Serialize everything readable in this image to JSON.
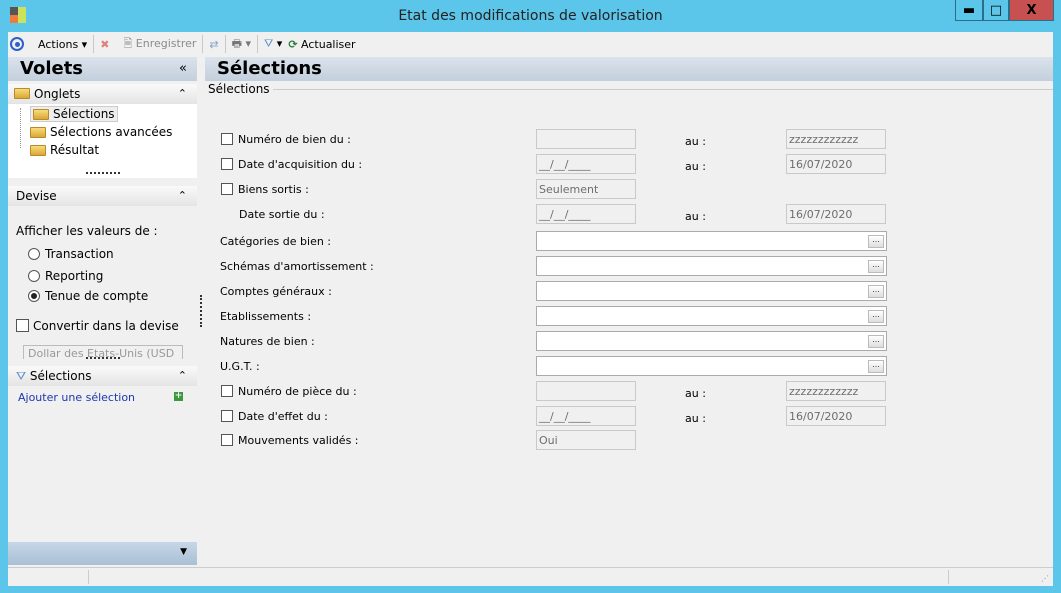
{
  "window": {
    "title": "Etat des modifications de valorisation",
    "minimize": "▬",
    "maximize": "□",
    "close": "X"
  },
  "toolbar": {
    "actions": "Actions",
    "save": "Enregistrer",
    "refresh": "Actualiser"
  },
  "left": {
    "title": "Volets",
    "collapse": "«",
    "onglets": {
      "title": "Onglets",
      "items": [
        "Sélections",
        "Sélections avancées",
        "Résultat"
      ]
    },
    "devise": {
      "title": "Devise",
      "prompt": "Afficher les valeurs de :",
      "options": [
        "Transaction",
        "Reporting",
        "Tenue de compte"
      ],
      "selected": 2,
      "convert_label": "Convertir dans la devise",
      "currency": "Dollar des Etats-Unis (USD"
    },
    "selections": {
      "title": "Sélections",
      "add_link": "Ajouter une sélection"
    }
  },
  "main": {
    "title": "Sélections",
    "group": "Sélections",
    "au": "au :",
    "rows": [
      {
        "label": "Numéro de bien du :",
        "check": true,
        "from": "",
        "to": "zzzzzzzzzzzz"
      },
      {
        "label": "Date d'acquisition du :",
        "check": true,
        "from": "__/__/____",
        "to": "16/07/2020"
      },
      {
        "label": "Biens sortis :",
        "check": true,
        "from": "Seulement"
      },
      {
        "label": "Date sortie du :",
        "from": "__/__/____",
        "to": "16/07/2020"
      },
      {
        "label": "Catégories de bien :"
      },
      {
        "label": "Schémas d'amortissement :"
      },
      {
        "label": "Comptes généraux :"
      },
      {
        "label": "Etablissements :"
      },
      {
        "label": "Natures de bien :"
      },
      {
        "label": "U.G.T. :"
      },
      {
        "label": "Numéro de pièce du :",
        "check": true,
        "from": "",
        "to": "zzzzzzzzzzzz"
      },
      {
        "label": "Date d'effet du :",
        "check": true,
        "from": "__/__/____",
        "to": "16/07/2020"
      },
      {
        "label": "Mouvements validés :",
        "check": true,
        "from": "Oui"
      }
    ],
    "ellipsis": "..."
  }
}
